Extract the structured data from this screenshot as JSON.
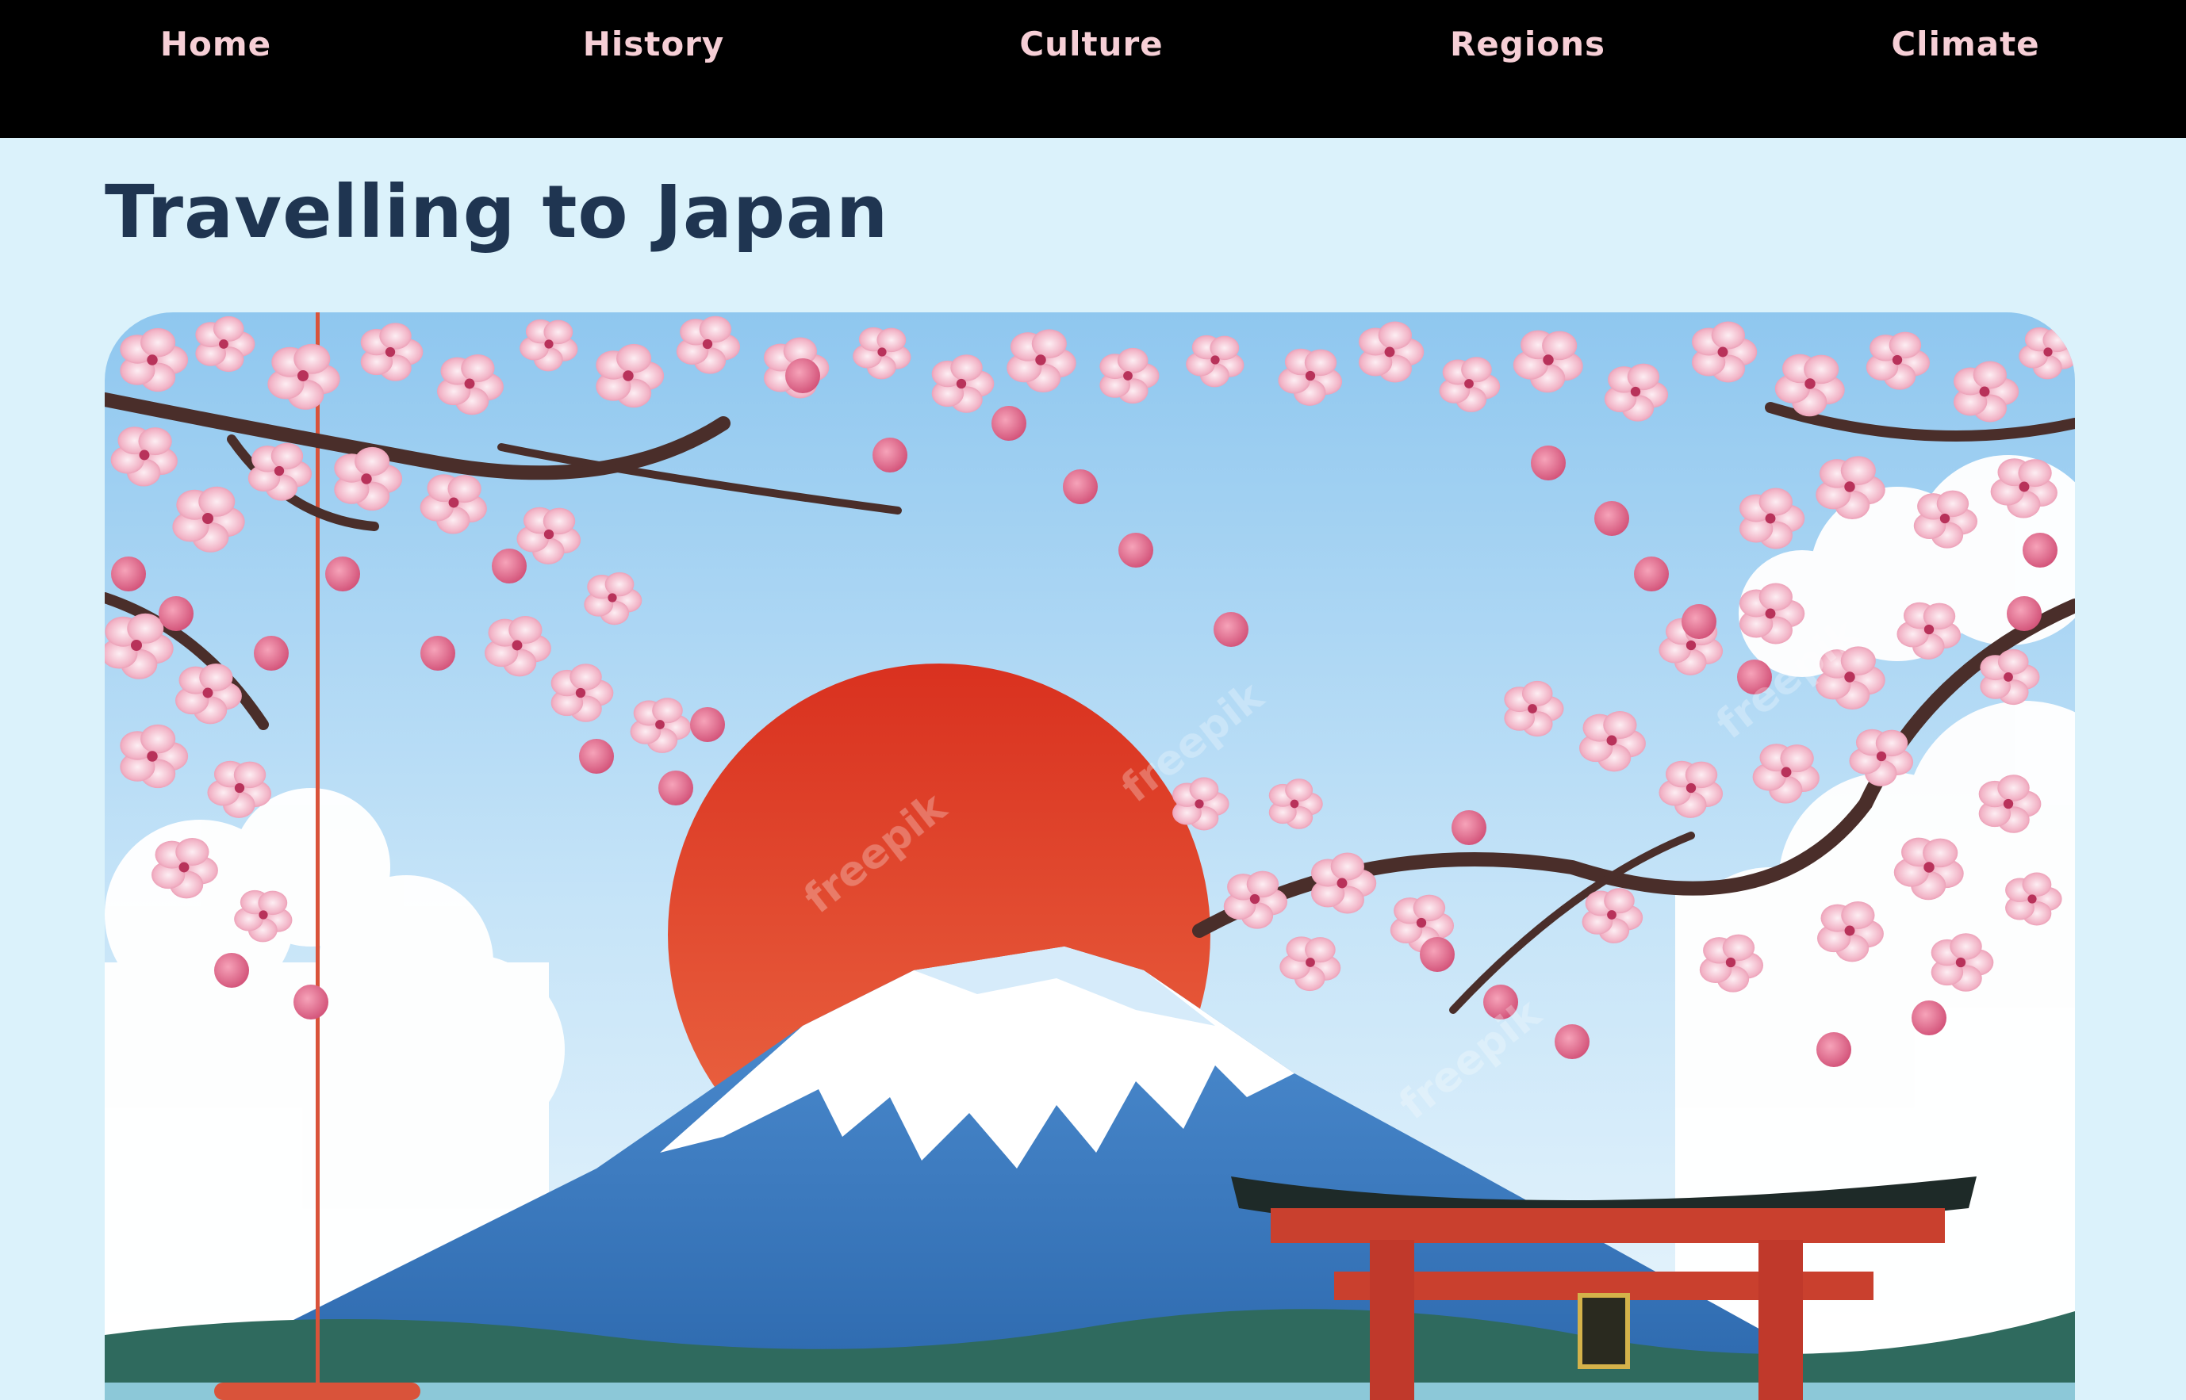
{
  "nav": {
    "items": [
      {
        "label": "Home"
      },
      {
        "label": "History"
      },
      {
        "label": "Culture"
      },
      {
        "label": "Regions"
      },
      {
        "label": "Climate"
      }
    ]
  },
  "page": {
    "title": "Travelling to Japan"
  },
  "hero": {
    "image": "illustration of Mount Fuji with red rising sun, cherry blossom branches and red torii gate",
    "watermark": "freepik"
  },
  "colors": {
    "nav_background": "#000000",
    "nav_text": "#f6cfd6",
    "page_background": "#dbf2fb",
    "title_text": "#1f3551",
    "sun": "#e0452b",
    "blossom": "#f3b8c8",
    "torii": "#c9402e"
  }
}
